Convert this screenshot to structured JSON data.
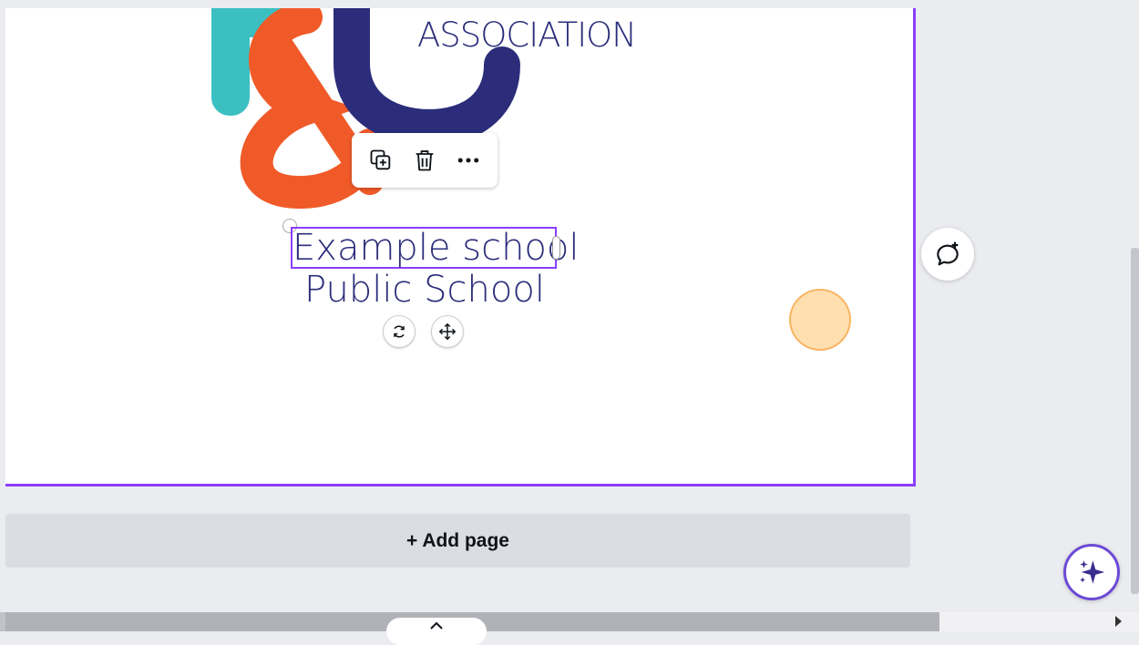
{
  "canvas": {
    "association_text": "ASSOCIATION",
    "text_line1": "Example school",
    "text_line2": "Public School"
  },
  "toolbar": {
    "duplicate": "Duplicate",
    "delete": "Delete",
    "more": "More"
  },
  "controls": {
    "rotate": "Rotate",
    "move": "Move"
  },
  "add_page_label": "+ Add page",
  "colors": {
    "selection": "#8b3dff",
    "brand_navy": "#2b2d7a",
    "logo_orange": "#f05a28",
    "logo_teal": "#3bbfc1"
  }
}
